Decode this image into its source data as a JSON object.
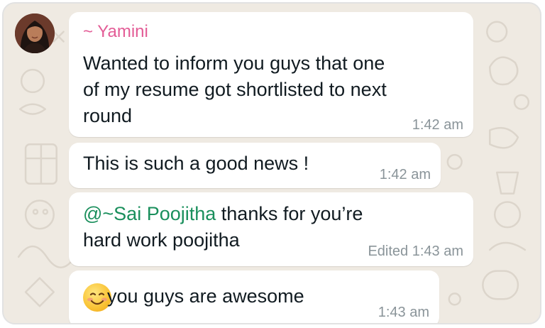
{
  "chat": {
    "messages": [
      {
        "sender": "~ Yamini",
        "lines": [
          "Wanted to inform you guys that one",
          "of my resume got shortlisted to next",
          "round"
        ],
        "time": "1:42 am"
      },
      {
        "text": "This is such a good news !",
        "time": "1:42 am"
      },
      {
        "mention": "@~Sai Poojitha",
        "line1_rest": " thanks for you’re",
        "line2": "hard work poojitha",
        "time": "Edited 1:43 am"
      },
      {
        "emoji": "smiling-face-emoji",
        "text": "you guys are awesome",
        "time": "1:43 am"
      }
    ]
  },
  "colors": {
    "background": "#efeae2",
    "sender_name": "#e35c96",
    "mention": "#1a8f5c",
    "timestamp": "#8a9499"
  }
}
